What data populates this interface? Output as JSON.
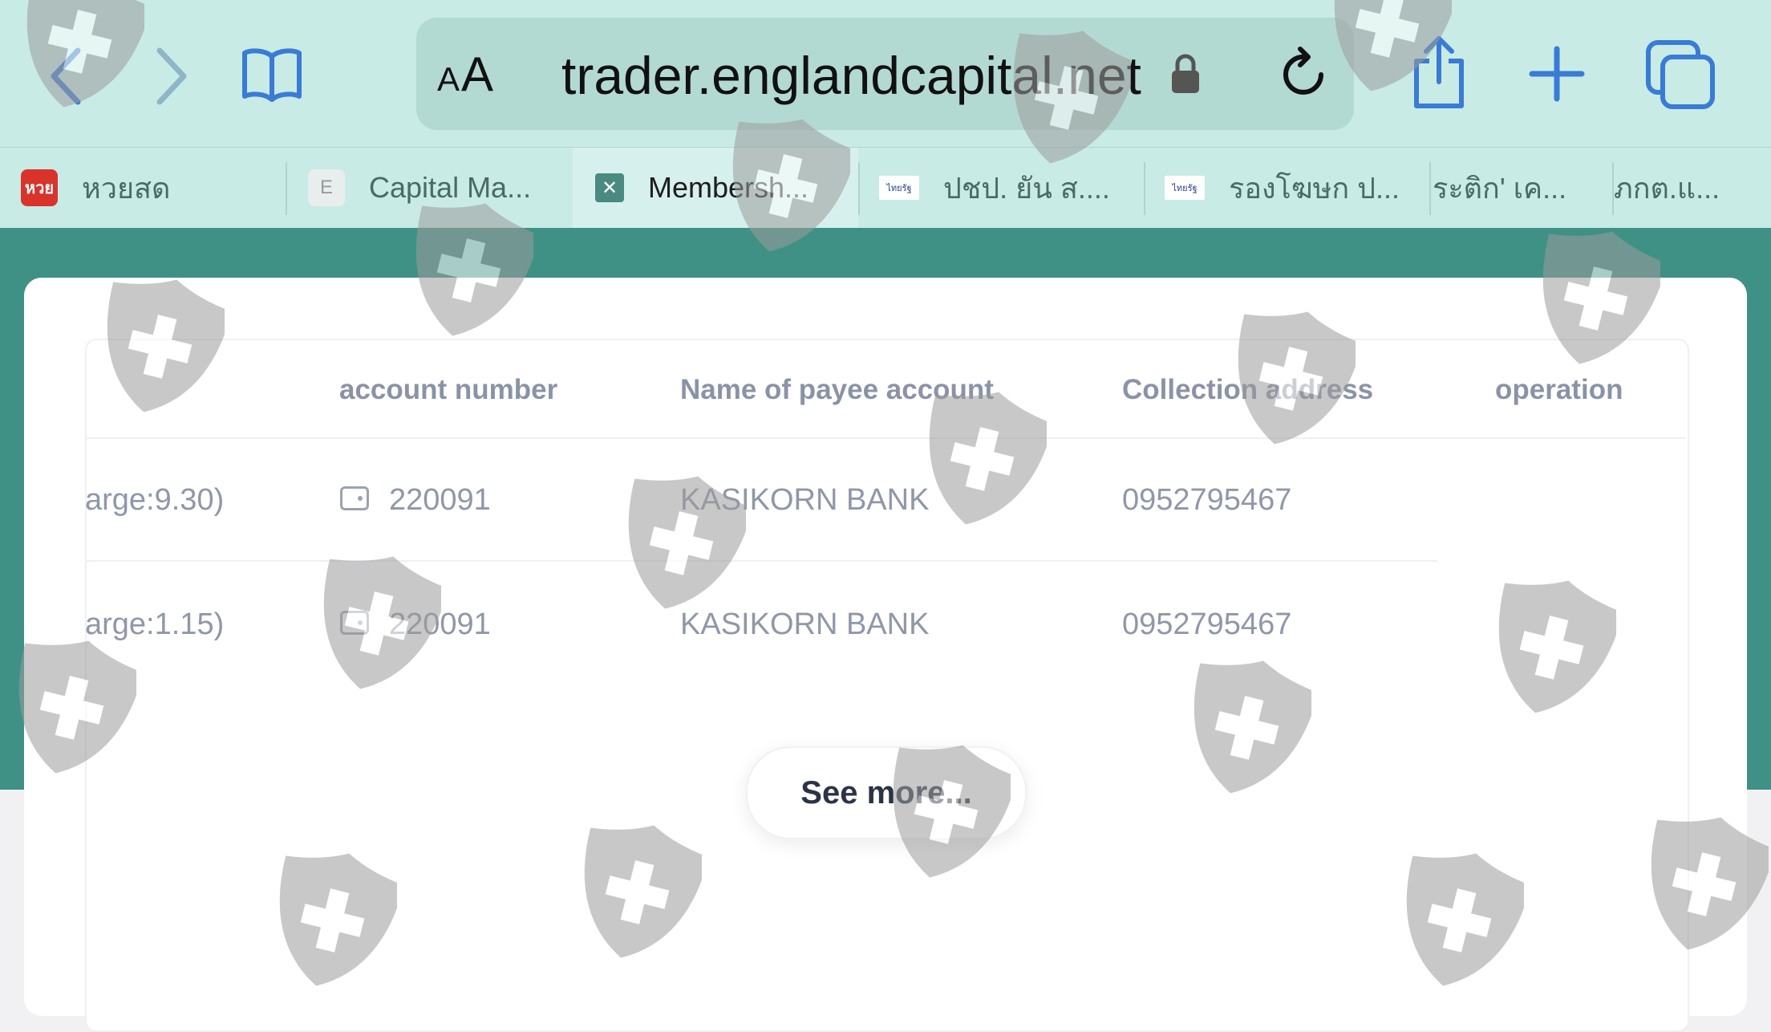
{
  "browser": {
    "url": "trader.englandcapital.net",
    "text_size_label_small": "A",
    "text_size_label_large": "A",
    "icons": [
      "back-icon",
      "forward-icon",
      "bookmarks-icon",
      "lock-icon",
      "reload-icon",
      "share-icon",
      "new-tab-icon",
      "tabs-overview-icon"
    ]
  },
  "tabs": [
    {
      "label": "หวยสด",
      "favicon_text": "หวย",
      "active": false
    },
    {
      "label": "Capital Ma...",
      "favicon_text": "E",
      "active": false
    },
    {
      "label": "Membersh...",
      "favicon_text": "✕",
      "active": true
    },
    {
      "label": "ปชป. ยัน ส....",
      "favicon_text": "ไทยรัฐ",
      "active": false
    },
    {
      "label": "รองโฆษก ป...",
      "favicon_text": "ไทยรัฐ",
      "active": false
    },
    {
      "label": "ระติก' เค...",
      "favicon_text": "",
      "active": false
    },
    {
      "label": "ภกต.แ...",
      "favicon_text": "",
      "active": false
    }
  ],
  "table": {
    "headers": [
      "account number",
      "Name of payee account",
      "Collection address",
      "operation"
    ],
    "rows": [
      {
        "first_col": "arge:9.30)",
        "account_number": "220091",
        "payee": "KASIKORN BANK",
        "address": "0952795467"
      },
      {
        "first_col": "arge:1.15)",
        "account_number": "220091",
        "payee": "KASIKORN BANK",
        "address": "0952795467"
      }
    ]
  },
  "see_more_label": "See more...",
  "colors": {
    "toolbar_bg": "#c8ebe6",
    "page_accent": "#3f9085",
    "ios_blue": "#3a7bd5"
  }
}
